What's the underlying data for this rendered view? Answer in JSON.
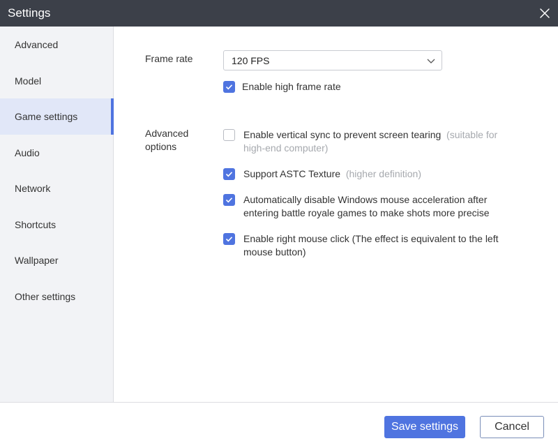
{
  "window": {
    "title": "Settings",
    "close_icon": "close-icon"
  },
  "sidebar": {
    "items": [
      {
        "label": "Advanced"
      },
      {
        "label": "Model"
      },
      {
        "label": "Game settings",
        "active": true
      },
      {
        "label": "Audio"
      },
      {
        "label": "Network"
      },
      {
        "label": "Shortcuts"
      },
      {
        "label": "Wallpaper"
      },
      {
        "label": "Other settings"
      }
    ]
  },
  "frame_rate": {
    "label": "Frame rate",
    "selected": "120 FPS",
    "high_frame_rate": {
      "label": "Enable high frame rate",
      "checked": true
    }
  },
  "advanced_options": {
    "label_line1": "Advanced",
    "label_line2": "options",
    "options": [
      {
        "line1": "Enable vertical sync to prevent screen tearing",
        "hint1": "(suitable for",
        "hint2": "high-end computer)",
        "checked": false
      },
      {
        "line1": "Support ASTC Texture",
        "hint1": "(higher definition)",
        "checked": true
      },
      {
        "line1": "Automatically disable Windows mouse acceleration after",
        "line2": "entering battle royale games to make shots more precise",
        "checked": true
      },
      {
        "line1": "Enable right mouse click (The effect is equivalent to the left",
        "line2": "mouse button)",
        "checked": true
      }
    ]
  },
  "footer": {
    "save_label": "Save settings",
    "cancel_label": "Cancel"
  },
  "colors": {
    "accent": "#4f74e0",
    "titlebar": "#3c4049",
    "sidebar_bg": "#f2f3f6",
    "active_bg": "#e1e7f8",
    "hint": "#a6a9ae"
  }
}
